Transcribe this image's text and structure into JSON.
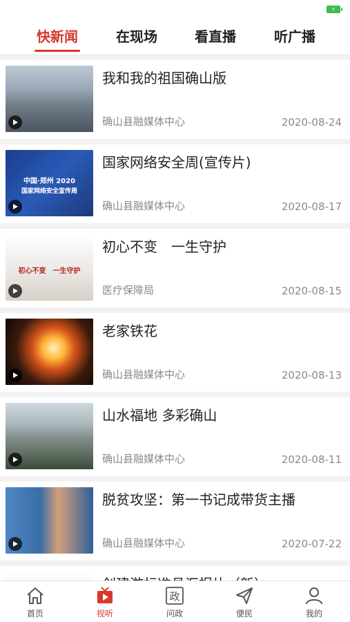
{
  "tabs": [
    {
      "label": "快新闻",
      "active": true
    },
    {
      "label": "在现场",
      "active": false
    },
    {
      "label": "看直播",
      "active": false
    },
    {
      "label": "听广播",
      "active": false
    }
  ],
  "feed": [
    {
      "title": "我和我的祖国确山版",
      "source": "确山县融媒体中心",
      "date": "2020-08-24"
    },
    {
      "title": "国家网络安全周(宣传片)",
      "source": "确山县融媒体中心",
      "date": "2020-08-17"
    },
    {
      "title": "初心不变　一生守护",
      "source": "医疗保障局",
      "date": "2020-08-15"
    },
    {
      "title": "老家铁花",
      "source": "确山县融媒体中心",
      "date": "2020-08-13"
    },
    {
      "title": "山水福地 多彩确山",
      "source": "确山县融媒体中心",
      "date": "2020-08-11"
    },
    {
      "title": "脱贫攻坚：第一书记成带货主播",
      "source": "确山县融媒体中心",
      "date": "2020-07-22"
    },
    {
      "title": "创建游标准县汇报片（新）",
      "source": "",
      "date": ""
    }
  ],
  "thumb_texts": {
    "t2_line1": "中国·郑州 2020",
    "t2_line2": "国家网络安全宣传周",
    "t3_line": "初心不变　一生守护"
  },
  "bottom_nav": [
    {
      "label": "首页",
      "icon": "home-icon",
      "active": false
    },
    {
      "label": "视听",
      "icon": "video-icon",
      "active": true
    },
    {
      "label": "问政",
      "icon": "politics-icon",
      "active": false
    },
    {
      "label": "便民",
      "icon": "send-icon",
      "active": false
    },
    {
      "label": "我的",
      "icon": "profile-icon",
      "active": false
    }
  ],
  "colors": {
    "accent": "#d9362c",
    "battery": "#3bbf4a"
  }
}
